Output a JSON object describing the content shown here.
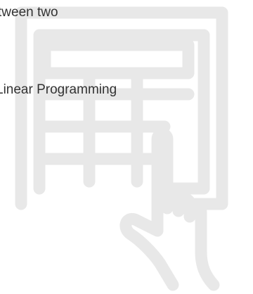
{
  "content": {
    "line_1": "tween two",
    "line_2": "Linear Programming"
  },
  "icon": {
    "name": "spreadsheet-hand-icon",
    "color": "#e8e8e8"
  },
  "colors": {
    "text": "#333333",
    "background": "#ffffff"
  }
}
